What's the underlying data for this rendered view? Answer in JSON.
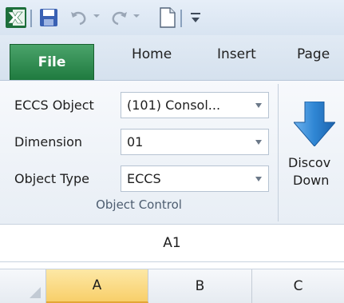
{
  "tabs": {
    "file": "File",
    "home": "Home",
    "insert": "Insert",
    "page": "Page"
  },
  "object_control": {
    "group_label": "Object Control",
    "rows": [
      {
        "label": "ECCS Object",
        "value": "(101) Consol..."
      },
      {
        "label": "Dimension",
        "value": "01"
      },
      {
        "label": "Object Type",
        "value": "ECCS"
      }
    ]
  },
  "discover": {
    "line1": "Discov",
    "line2": "Down"
  },
  "name_box": {
    "value": "A1"
  },
  "columns": [
    "A",
    "B",
    "C"
  ],
  "colors": {
    "file_tab": "#1f7a3f",
    "selected_column": "#f8cf6a",
    "ribbon_bg": "#e8eef5"
  }
}
